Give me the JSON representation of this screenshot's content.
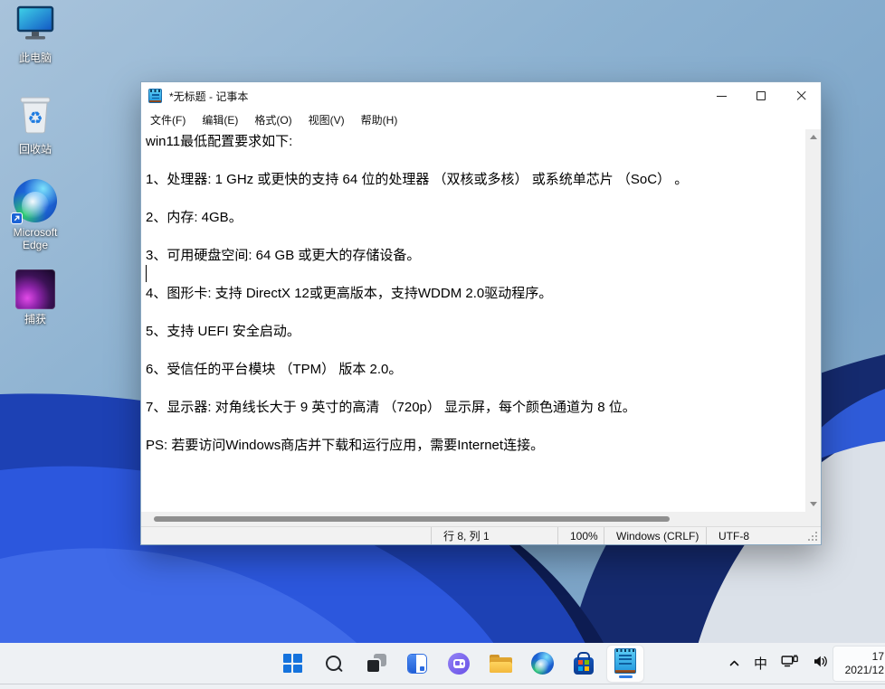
{
  "desktop": {
    "icons": [
      {
        "label": "此电脑"
      },
      {
        "label": "回收站"
      },
      {
        "label": "Microsoft Edge"
      },
      {
        "label": "捕获"
      }
    ]
  },
  "notepad": {
    "title": "*无标题 - 记事本",
    "menu": [
      {
        "label": "文件(F)"
      },
      {
        "label": "编辑(E)"
      },
      {
        "label": "格式(O)"
      },
      {
        "label": "视图(V)"
      },
      {
        "label": "帮助(H)"
      }
    ],
    "lines": [
      "win11最低配置要求如下:",
      "",
      "1、处理器: 1 GHz 或更快的支持 64 位的处理器 （双核或多核） 或系统单芯片 （SoC） 。",
      "",
      "2、内存: 4GB。",
      "",
      "3、可用硬盘空间: 64 GB 或更大的存储设备。",
      "",
      "4、图形卡: 支持 DirectX 12或更高版本，支持WDDM 2.0驱动程序。",
      "",
      "5、支持 UEFI 安全启动。",
      "",
      "6、受信任的平台模块 （TPM） 版本 2.0。",
      "",
      "7、显示器: 对角线长大于 9 英寸的高清 （720p） 显示屏，每个颜色通道为 8 位。",
      "",
      "PS: 若要访问Windows商店并下载和运行应用，需要Internet连接。"
    ],
    "status": {
      "cursor_position": "行 8, 列 1",
      "zoom_level": "100%",
      "line_ending": "Windows (CRLF)",
      "encoding": "UTF-8"
    }
  },
  "taskbar": {
    "tray": {
      "ime_label": "中",
      "time": "17",
      "date": "2021/12"
    }
  },
  "colors": {
    "accent_blue": "#2e7ce4",
    "taskbar_bg": "#eef1f4",
    "wallpaper_steel_blue": "#8db2d1",
    "wallpaper_royal_blue": "#2c57dd",
    "notepad_icon_blue": "#2196d6"
  }
}
